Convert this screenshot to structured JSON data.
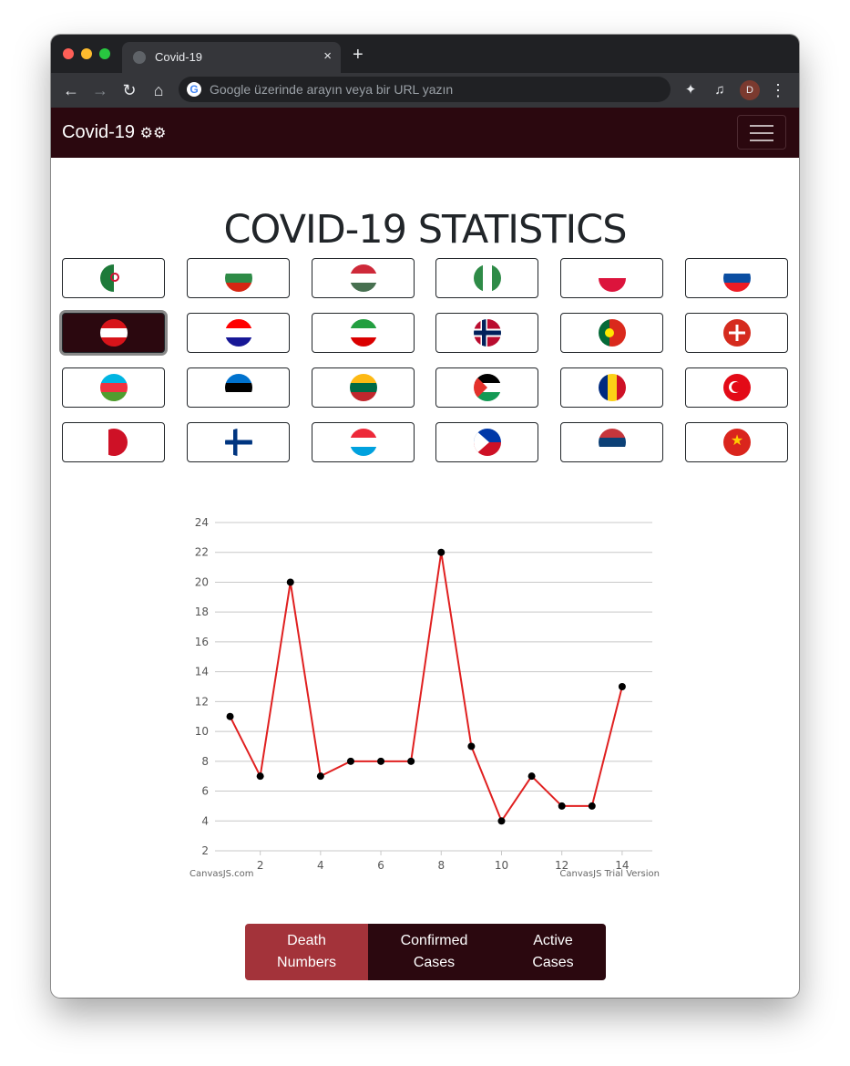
{
  "browser": {
    "tab_title": "Covid-19",
    "tab_close": "×",
    "new_tab": "+",
    "omnibox_placeholder": "Google üzerinde arayın veya bir URL yazın",
    "google_letter": "G",
    "avatar_letter": "D",
    "back": "←",
    "forward": "→",
    "reload": "↻",
    "home": "⌂",
    "extensions": "✦",
    "media": "♫",
    "menu": "⋮"
  },
  "navbar": {
    "brand": "Covid-19",
    "brand_icon": "⚙⚙"
  },
  "page": {
    "title": "COVID-19 STATISTICS"
  },
  "flags": [
    [
      "algeria",
      "bulgaria",
      "hungary",
      "nigeria",
      "poland",
      "slovakia"
    ],
    [
      "austria",
      "croatia",
      "iran",
      "norway",
      "portugal",
      "switzerland"
    ],
    [
      "azerbaijan",
      "estonia",
      "lithuania",
      "palestine",
      "romania",
      "turkey"
    ],
    [
      "bahrain",
      "finland",
      "luxembourg",
      "philippines",
      "serbia",
      "vietnam"
    ]
  ],
  "active_flag": "austria",
  "chart_data": {
    "type": "line",
    "x": [
      1,
      2,
      3,
      4,
      5,
      6,
      7,
      8,
      9,
      10,
      11,
      12,
      13,
      14
    ],
    "series": [
      {
        "values": [
          11,
          7,
          20,
          7,
          8,
          8,
          8,
          22,
          9,
          4,
          7,
          5,
          5,
          13
        ],
        "color": "#e02020"
      }
    ],
    "xticks": [
      2,
      4,
      6,
      8,
      10,
      12,
      14
    ],
    "yticks": [
      2,
      4,
      6,
      8,
      10,
      12,
      14,
      16,
      18,
      20,
      22,
      24
    ],
    "xlim": [
      0.5,
      15
    ],
    "ylim": [
      2,
      24
    ],
    "credit_left": "CanvasJS.com",
    "credit_right": "CanvasJS Trial Version"
  },
  "buttons": {
    "death": "Death Numbers",
    "confirmed": "Confirmed Cases",
    "active": "Active Cases"
  },
  "colors": {
    "navbar": "#2b080f",
    "active_button": "#a3333a",
    "line": "#e02020"
  }
}
